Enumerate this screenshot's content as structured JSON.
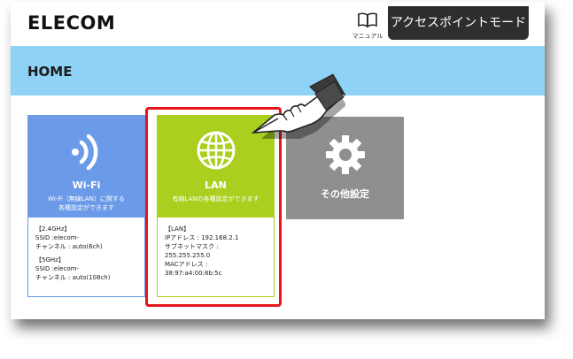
{
  "header": {
    "logo": "ELECOM",
    "manual_label": "マニュアル",
    "mode_button": "アクセスポイントモード"
  },
  "page": {
    "title": "HOME"
  },
  "tiles": {
    "wifi": {
      "title": "Wi-Fi",
      "desc_line1": "Wi-Fi（無線LAN）に関する",
      "desc_line2": "各種設定ができます",
      "info": [
        "【2.4GHz】",
        "SSID :elecom-",
        "チャンネル : auto(6ch)",
        "【5GHz】",
        "SSID :elecom-",
        "チャンネル : auto(108ch)"
      ]
    },
    "lan": {
      "title": "LAN",
      "desc": "有線LANの各種設定ができます",
      "info": [
        "【LAN】",
        "IPアドレス : 192.168.2.1",
        "サブネットマスク :",
        "255.255.255.0",
        "MACアドレス :",
        "38:97:a4:00:8b:5c"
      ]
    },
    "other": {
      "title": "その他設定"
    }
  },
  "colors": {
    "wifi": "#6b9be8",
    "lan": "#aacf1e",
    "other": "#8f8f8f",
    "band": "#8ed3f5",
    "highlight": "#e8141b"
  },
  "icons": [
    "book-icon",
    "wifi-icon",
    "globe-icon",
    "gear-icon",
    "pointing-hand-icon"
  ]
}
